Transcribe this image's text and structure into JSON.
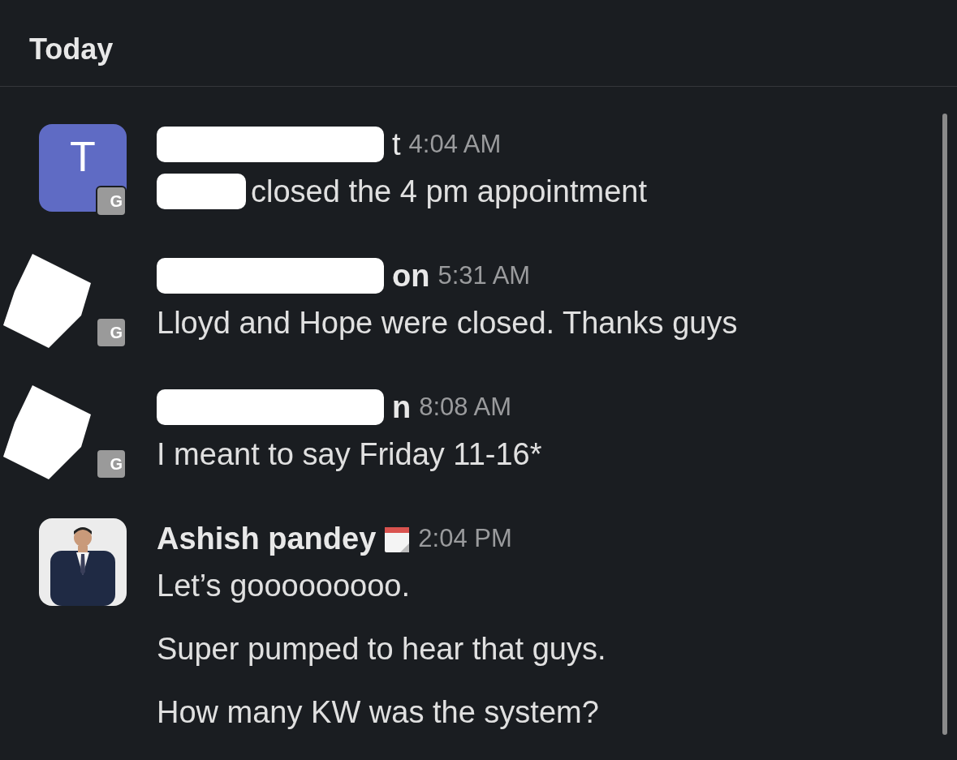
{
  "header": {
    "title": "Today"
  },
  "messages": [
    {
      "kind": "letter",
      "avatar_letter": "T",
      "badge": "G",
      "name_visible": "t",
      "time": "4:04 AM",
      "lines": [
        "closed the 4 pm appointment"
      ]
    },
    {
      "kind": "hidden",
      "badge": "G",
      "name_visible": "on",
      "time": "5:31 AM",
      "lines": [
        "Lloyd and Hope were closed. Thanks guys"
      ]
    },
    {
      "kind": "hidden",
      "badge": "G",
      "name_visible": "n",
      "time": "8:08 AM",
      "lines": [
        "I meant to say Friday 11-16*"
      ]
    },
    {
      "kind": "picture",
      "name_visible": "Ashish pandey",
      "time": "2:04 PM",
      "lines": [
        "Let’s gooooooooo.",
        "Super pumped to hear that guys.",
        "How many KW was the system?"
      ]
    }
  ]
}
